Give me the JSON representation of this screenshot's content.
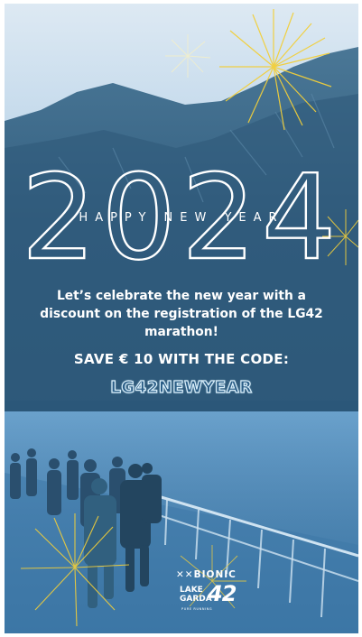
{
  "poster": {
    "year": "2024",
    "greeting": "HAPPY NEW YEAR",
    "message": "Let’s celebrate the new year with a discount on the registration of the LG42 marathon!",
    "offer": "SAVE € 10 WITH THE CODE:",
    "promo_code": "LG42NEWYEAR"
  },
  "logo": {
    "brand": "BIONIC",
    "event_line1": "LAKE",
    "event_line2": "GARDA",
    "event_number": "42",
    "tagline": "PURE RUNNING"
  },
  "colors": {
    "sky": "#c9dfef",
    "mountain": "#3a6788",
    "lake": "#4f8dbf",
    "fireworks": "#f2cf3a",
    "code_fill": "#2a5d86"
  }
}
